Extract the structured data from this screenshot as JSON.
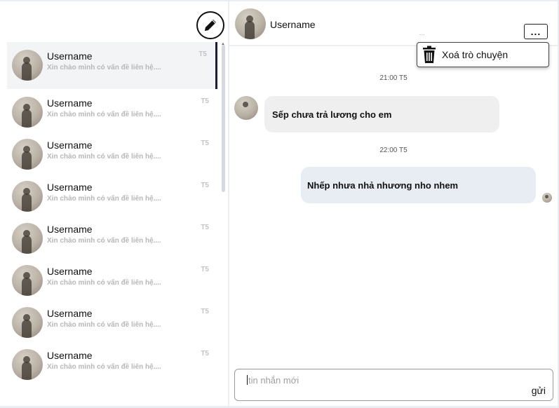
{
  "sidebar": {
    "conversations": [
      {
        "name": "Username",
        "preview": "Xin chào mình có vấn đề liên hệ....",
        "time": "T5"
      },
      {
        "name": "Username",
        "preview": "Xin chào mình có vấn đề liên hệ....",
        "time": "T5"
      },
      {
        "name": "Username",
        "preview": "Xin chào mình có vấn đề liên hệ....",
        "time": "T5"
      },
      {
        "name": "Username",
        "preview": "Xin chào mình có vấn đề liên hệ....",
        "time": "T5"
      },
      {
        "name": "Username",
        "preview": "Xin chào mình có vấn đề liên hệ....",
        "time": "T5"
      },
      {
        "name": "Username",
        "preview": "Xin chào mình có vấn đề liên hệ....",
        "time": "T5"
      },
      {
        "name": "Username",
        "preview": "Xin chào mình có vấn đề liên hệ....",
        "time": "T5"
      },
      {
        "name": "Username",
        "preview": "Xin chào mình có vấn đề liên hệ....",
        "time": "T5"
      }
    ]
  },
  "chat": {
    "header_name": "Username",
    "more_label": "...",
    "more_faint": "...",
    "menu_delete_label": "Xoá trò chuyện",
    "messages": [
      {
        "timestamp": "21:00 T5",
        "text": "Sếp chưa trả lương cho em",
        "direction": "incoming"
      },
      {
        "timestamp": "22:00 T5",
        "text": "Nhếp nhưa nhả nhương nho nhem",
        "direction": "outgoing"
      }
    ],
    "input_placeholder": "tin nhắn mới",
    "send_label": "gửi"
  }
}
